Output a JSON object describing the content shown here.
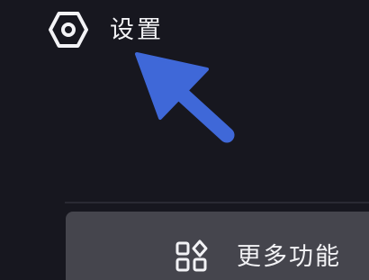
{
  "settings": {
    "icon": "hexagon-settings-icon",
    "label": "设置"
  },
  "annotation": {
    "icon": "pointer-arrow-icon",
    "color": "#3f68d8"
  },
  "more": {
    "icon": "apps-grid-icon",
    "label": "更多功能"
  },
  "colors": {
    "background": "#17171f",
    "panel": "#45454d",
    "text": "#f3f3f6"
  }
}
